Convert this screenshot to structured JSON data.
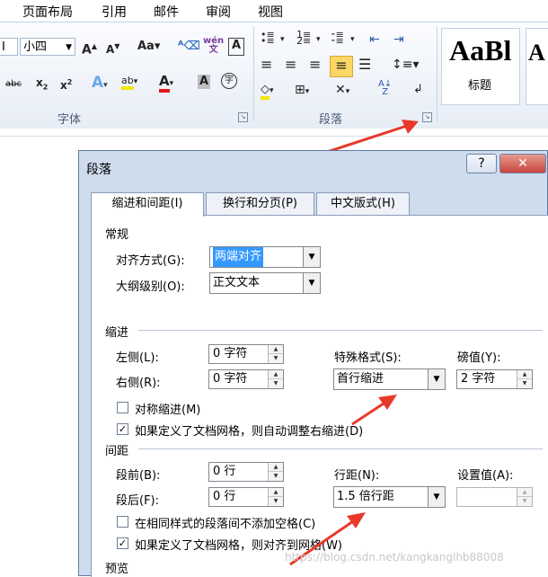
{
  "menubar": {
    "items": [
      "页面布局",
      "引用",
      "邮件",
      "审阅",
      "视图"
    ]
  },
  "ribbon": {
    "font_size": "小四",
    "font_group_label": "字体",
    "paragraph_group_label": "段落",
    "style_preview": "AaBl",
    "style_label": "标题",
    "style_preview2": "A"
  },
  "dialog": {
    "title": "段落",
    "help_label": "?",
    "close_label": "✕",
    "tabs": [
      "缩进和间距(I)",
      "换行和分页(P)",
      "中文版式(H)"
    ],
    "general": {
      "title": "常规",
      "align_label": "对齐方式(G):",
      "align_value": "两端对齐",
      "outline_label": "大纲级别(O):",
      "outline_value": "正文文本"
    },
    "indent": {
      "title": "缩进",
      "left_label": "左侧(L):",
      "left_value": "0 字符",
      "right_label": "右侧(R):",
      "right_value": "0 字符",
      "special_label": "特殊格式(S):",
      "special_value": "首行缩进",
      "by_label": "磅值(Y):",
      "by_value": "2 字符",
      "mirror_label": "对称缩进(M)",
      "mirror_checked": false,
      "grid_label": "如果定义了文档网格，则自动调整右缩进(D)",
      "grid_checked": true
    },
    "spacing": {
      "title": "间距",
      "before_label": "段前(B):",
      "before_value": "0 行",
      "after_label": "段后(F):",
      "after_value": "0 行",
      "line_label": "行距(N):",
      "line_value": "1.5 倍行距",
      "at_label": "设置值(A):",
      "at_value": "",
      "no_space_label": "在相同样式的段落间不添加空格(C)",
      "no_space_checked": false,
      "snap_label": "如果定义了文档网格，则对齐到网格(W)",
      "snap_checked": true
    },
    "preview": {
      "title": "预览"
    }
  },
  "watermark": "https://blog.csdn.net/kangkanglhb88008",
  "colors": {
    "accent": "#3399ff",
    "arrow": "#e8392b",
    "close": "#c9463d",
    "highlight": "#fbd765"
  }
}
